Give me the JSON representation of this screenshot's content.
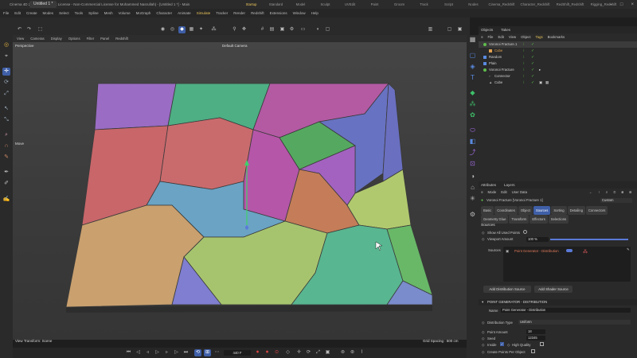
{
  "titlebar": {
    "title": "Cinema 4D 2025.1.2 (Student License - Non-Commercial License for Mohammed Nasrullah) - [Untitled 1 *] - Main"
  },
  "doc_tab": "Untitled 1 *",
  "menu": [
    "File",
    "Edit",
    "Create",
    "Modes",
    "Select",
    "Tools",
    "Spline",
    "Mesh",
    "Volume",
    "MoGraph",
    "Character",
    "Animate",
    "Simulate",
    "Tracker",
    "Render",
    "Redshift",
    "Extensions",
    "Window",
    "Help"
  ],
  "layouts": [
    "Startup",
    "Standard",
    "Model",
    "Sculpt",
    "UVEdit",
    "Paint",
    "Groom",
    "Track",
    "Script",
    "Nodes",
    "Cinema_Redshift",
    "Character_Redshift",
    "RedShift_Redshift",
    "Rigging_Redshift"
  ],
  "viewport": {
    "menu": [
      "View",
      "Cameras",
      "Display",
      "Options",
      "Filter",
      "Panel",
      "Redshift"
    ],
    "label": "Perspective",
    "camera": "Default Camera",
    "move_label": "Move",
    "transform_label": "View Transform: Scene",
    "grid_label": "Grid Spacing : 500 cm"
  },
  "timeline": {
    "frame": "440 F"
  },
  "objects": {
    "tabs": [
      "Objects",
      "Takes"
    ],
    "menu": [
      "File",
      "Edit",
      "View",
      "Object",
      "Tags",
      "Bookmarks"
    ],
    "rows": [
      {
        "name": "Voronoi Fracture.1",
        "color": "#c84a3a"
      },
      {
        "name": "Cube",
        "color": "#e0a050"
      },
      {
        "name": "Random",
        "color": "#5fbd4c"
      },
      {
        "name": "Plain",
        "color": "#5fbd4c"
      },
      {
        "name": "Voronoi Fracture",
        "color": "#5fbd4c"
      },
      {
        "name": "Connector",
        "color": "#c0c0c0"
      },
      {
        "name": "Cube",
        "color": "#e0a050"
      }
    ]
  },
  "attributes": {
    "tabs": [
      "Attributes",
      "Layers"
    ],
    "menu": [
      "Mode",
      "Edit",
      "User Data"
    ],
    "object_title": "Voronoi Fracture [Voronoi Fracture 1]",
    "preset": "Custom",
    "subtabs": [
      "Basic",
      "Coordinates",
      "Object",
      "Sources",
      "Sorting",
      "Detailing",
      "Connectors",
      "Geometry Glue",
      "Transform",
      "Effectors",
      "Selections"
    ],
    "section": "Sources",
    "show_all_label": "Show All Used Points",
    "viewport_amount_label": "Viewport Amount",
    "viewport_amount_value": "100 %",
    "viewport_amount": 1.0,
    "sources_label": "Sources",
    "source_item": "Point Generator - Distribution",
    "add_distribution": "Add Distribution Source",
    "add_shader": "Add Shader Source",
    "pg_header": "POINT GENERATOR - DISTRIBUTION",
    "name_label": "Name",
    "name_value": "Point Generator - Distribution",
    "dist_type_label": "Distribution Type",
    "dist_type_value": "Uniform",
    "point_amount_label": "Point Amount",
    "point_amount_value": "18",
    "seed_label": "Seed",
    "seed_value": "12345",
    "inside_label": "Inside",
    "high_quality_label": "High Quality",
    "create_points_label": "Create Points Per Object"
  },
  "colors": {
    "accent": "#3f5fa7",
    "highlight": "#e8c45a",
    "check": "#5fbd4c"
  }
}
